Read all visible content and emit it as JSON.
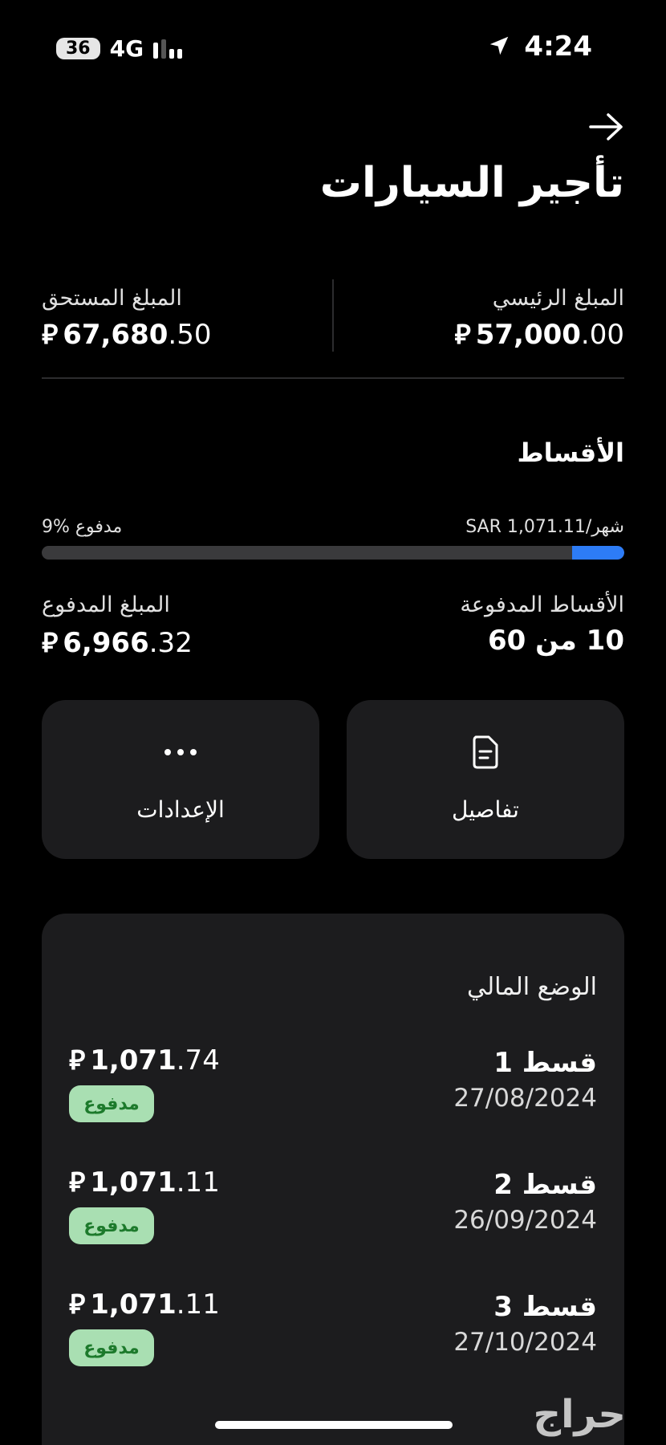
{
  "status_bar": {
    "battery": "36",
    "network": "4G",
    "time": "4:24"
  },
  "header": {
    "title": "تأجير السيارات"
  },
  "summary": {
    "principal_label": "المبلغ الرئيسي",
    "principal_int": "57,000",
    "principal_dec": ".00",
    "due_label": "المبلغ المستحق",
    "due_int": "67,680",
    "due_dec": ".50",
    "currency_symbol": "⃁"
  },
  "installments": {
    "section_title": "الأقساط",
    "monthly_text": "SAR 1,071.11/شهر",
    "paid_percent_text": "9% مدفوع",
    "progress_fraction": 0.09,
    "paid_installments_label": "الأقساط المدفوعة",
    "paid_installments_value": "10 من 60",
    "paid_amount_label": "المبلغ المدفوع",
    "paid_amount_int": "6,966",
    "paid_amount_dec": ".32"
  },
  "actions": {
    "details_label": "تفاصيل",
    "settings_label": "الإعدادات"
  },
  "financial": {
    "title": "الوضع المالي",
    "rows": [
      {
        "name": "قسط 1",
        "date": "27/08/2024",
        "amount_int": "1,071",
        "amount_dec": ".74",
        "status": "مدفوع"
      },
      {
        "name": "قسط 2",
        "date": "26/09/2024",
        "amount_int": "1,071",
        "amount_dec": ".11",
        "status": "مدفوع"
      },
      {
        "name": "قسط 3",
        "date": "27/10/2024",
        "amount_int": "1,071",
        "amount_dec": ".11",
        "status": "مدفوع"
      }
    ]
  },
  "watermark": "حراج",
  "colors": {
    "accent": "#2d7cf6",
    "paid_badge_bg": "#a9dfb2",
    "paid_badge_text": "#1d7a2c",
    "card_bg": "#1c1c1e"
  }
}
